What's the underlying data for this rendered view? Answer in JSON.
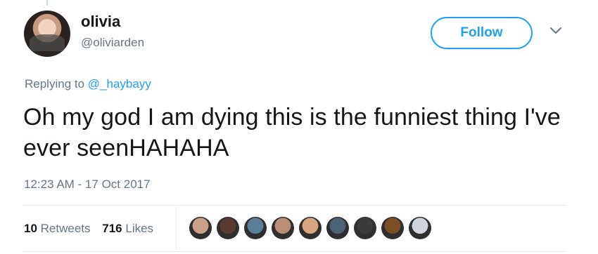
{
  "tweet": {
    "display_name": "olivia",
    "username": "@oliviarden",
    "follow_label": "Follow",
    "reply_prefix": "Replying to",
    "reply_to": "@_haybayy",
    "text": "Oh my god I am dying this is the funniest thing I've ever seenHAHAHA",
    "timestamp": "12:23 AM - 17 Oct 2017"
  },
  "stats": {
    "retweets_count": "10",
    "retweets_label": "Retweets",
    "likes_count": "716",
    "likes_label": "Likes"
  },
  "likers": [
    {
      "icon": "avatar-1",
      "color": "#c9a08a"
    },
    {
      "icon": "avatar-2",
      "color": "#5a3b32"
    },
    {
      "icon": "avatar-3",
      "color": "#5d7e97"
    },
    {
      "icon": "avatar-4",
      "color": "#b88e77"
    },
    {
      "icon": "avatar-5",
      "color": "#d7a57f"
    },
    {
      "icon": "avatar-6",
      "color": "#4d6275"
    },
    {
      "icon": "avatar-7",
      "color": "#3b3b3b"
    },
    {
      "icon": "avatar-8",
      "color": "#7a4f26"
    },
    {
      "icon": "avatar-9",
      "color": "#cfd5db"
    }
  ],
  "colors": {
    "accent": "#1da1f2",
    "secondary_text": "#657786",
    "primary_text": "#14171a",
    "divider": "#e6ecf0"
  }
}
